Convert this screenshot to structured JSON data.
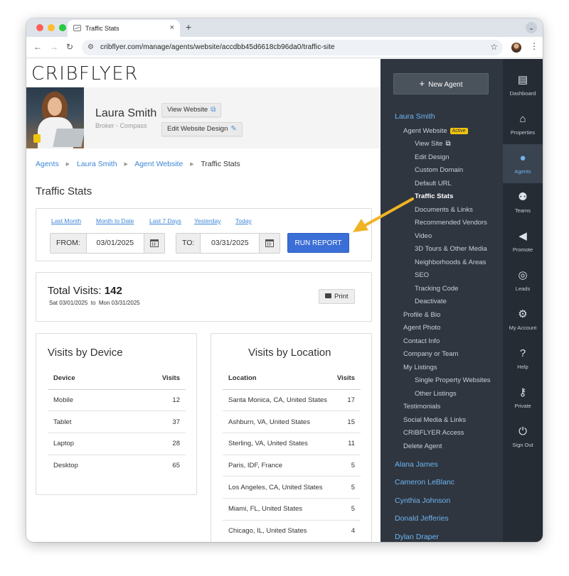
{
  "browser": {
    "tab_title": "Traffic Stats",
    "tab_close": "×",
    "new_tab": "+",
    "tab_menu": "⌄",
    "url": "cribflyer.com/manage/agents/website/accdbb45d6618cb96da0/traffic-site",
    "back": "←",
    "forward": "→",
    "reload": "↻",
    "star": "☆",
    "menu": "⋮"
  },
  "brand": "CRIBFLYER",
  "agent": {
    "name": "Laura Smith",
    "role": "Broker - Compass",
    "view_website": "View Website",
    "edit_design": "Edit Website Design"
  },
  "breadcrumbs": [
    {
      "label": "Agents"
    },
    {
      "label": "Laura Smith"
    },
    {
      "label": "Agent Website"
    },
    {
      "label": "Traffic Stats"
    }
  ],
  "page_title": "Traffic Stats",
  "range": {
    "quick": [
      "Last Month",
      "Month to Date",
      "Last 7 Days",
      "Yesterday",
      "Today"
    ],
    "from_label": "FROM:",
    "from_value": "03/01/2025",
    "to_label": "TO:",
    "to_value": "03/31/2025",
    "run": "RUN REPORT"
  },
  "totals": {
    "label": "Total Visits:",
    "value": "142",
    "start_day": "Sat",
    "start": "03/01/2025",
    "to": "to",
    "end_day": "Mon",
    "end": "03/31/2025",
    "print": "Print"
  },
  "device": {
    "title": "Visits by Device",
    "col1": "Device",
    "col2": "Visits",
    "rows": [
      {
        "name": "Mobile",
        "visits": "12"
      },
      {
        "name": "Tablet",
        "visits": "37"
      },
      {
        "name": "Laptop",
        "visits": "28"
      },
      {
        "name": "Desktop",
        "visits": "65"
      }
    ]
  },
  "location": {
    "title": "Visits by Location",
    "col1": "Location",
    "col2": "Visits",
    "rows": [
      {
        "name": "Santa Monica, CA, United States",
        "visits": "17"
      },
      {
        "name": "Ashburn, VA, United States",
        "visits": "15"
      },
      {
        "name": "Sterling, VA, United States",
        "visits": "11"
      },
      {
        "name": "Paris, IDF, France",
        "visits": "5"
      },
      {
        "name": "Los Angeles, CA, United States",
        "visits": "5"
      },
      {
        "name": "Miami, FL, United States",
        "visits": "5"
      },
      {
        "name": "Chicago, IL, United States",
        "visits": "4"
      }
    ]
  },
  "sidebar": {
    "new_agent": "New Agent",
    "current_agent": "Laura Smith",
    "agent_website": "Agent Website",
    "active_badge": "Active",
    "website_items": [
      "View Site",
      "Edit Design",
      "Custom Domain",
      "Default URL",
      "Traffic Stats",
      "Documents & Links",
      "Recommended Vendors",
      "Video",
      "3D Tours & Other Media",
      "Neighborhoods & Areas",
      "SEO",
      "Tracking Code",
      "Deactivate"
    ],
    "agent_items_a": [
      "Profile & Bio",
      "Agent Photo",
      "Contact Info",
      "Company or Team",
      "My Listings"
    ],
    "listing_items": [
      "Single Property Websites",
      "Other Listings"
    ],
    "agent_items_b": [
      "Testimonials",
      "Social Media & Links",
      "CRIBFLYER Access",
      "Delete Agent"
    ],
    "other_agents": [
      "Alana James",
      "Cameron LeBlanc",
      "Cynthia Johnson",
      "Donald Jefferies",
      "Dylan Draper"
    ]
  },
  "iconbar": [
    {
      "label": "Dashboard",
      "icon": "dashboard-icon"
    },
    {
      "label": "Properties",
      "icon": "properties-icon"
    },
    {
      "label": "Agents",
      "icon": "agents-icon"
    },
    {
      "label": "Teams",
      "icon": "teams-icon"
    },
    {
      "label": "Promote",
      "icon": "megaphone-icon"
    },
    {
      "label": "Leads",
      "icon": "target-icon"
    },
    {
      "label": "My Account",
      "icon": "gear-icon"
    },
    {
      "label": "Help",
      "icon": "help-icon"
    },
    {
      "label": "Private",
      "icon": "key-icon"
    },
    {
      "label": "Sign Out",
      "icon": "power-icon"
    }
  ],
  "colors": {
    "accent_blue": "#3b6ed6",
    "link_blue": "#3d86d6",
    "sidebar_bg": "#2f3640",
    "badge_yellow": "#f1c40f",
    "annotation_arrow": "#f0b323"
  }
}
